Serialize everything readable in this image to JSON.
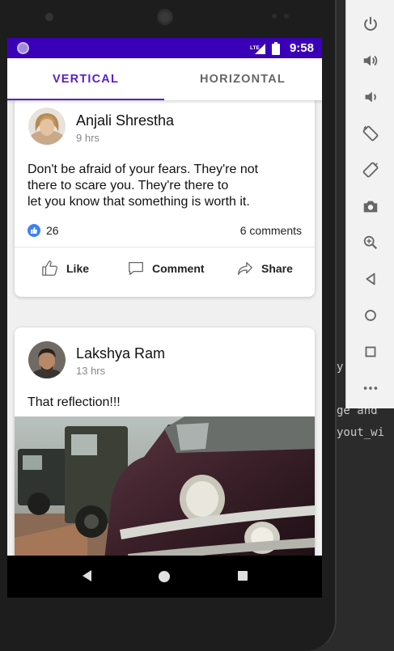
{
  "ide": {
    "line1": "y",
    "line2": "ge and ",
    "line3": "yout_wi"
  },
  "status_bar": {
    "time": "9:58",
    "network": "LTE"
  },
  "tabs": [
    {
      "label": "VERTICAL",
      "selected": true
    },
    {
      "label": "HORIZONTAL",
      "selected": false
    }
  ],
  "posts": [
    {
      "author": "Anjali Shrestha",
      "time": "9 hrs",
      "text_lines": [
        "Don't be afraid of your fears. They're not",
        "there to scare you. They're there to",
        "let you know that something is worth it."
      ],
      "likes": "26",
      "comments": "6 comments",
      "actions": {
        "like": "Like",
        "comment": "Comment",
        "share": "Share"
      }
    },
    {
      "author": "Lakshya Ram",
      "time": "13 hrs",
      "text": "That reflection!!!"
    }
  ],
  "emulator_controls": [
    "power-icon",
    "volume-up-icon",
    "volume-down-icon",
    "rotate-left-icon",
    "rotate-right-icon",
    "camera-icon",
    "zoom-in-icon",
    "back-icon",
    "home-icon",
    "overview-icon",
    "more-icon"
  ],
  "colors": {
    "primary": "#3a00b8",
    "accent": "#5a1fc7",
    "like_blue": "#3b82f6"
  }
}
